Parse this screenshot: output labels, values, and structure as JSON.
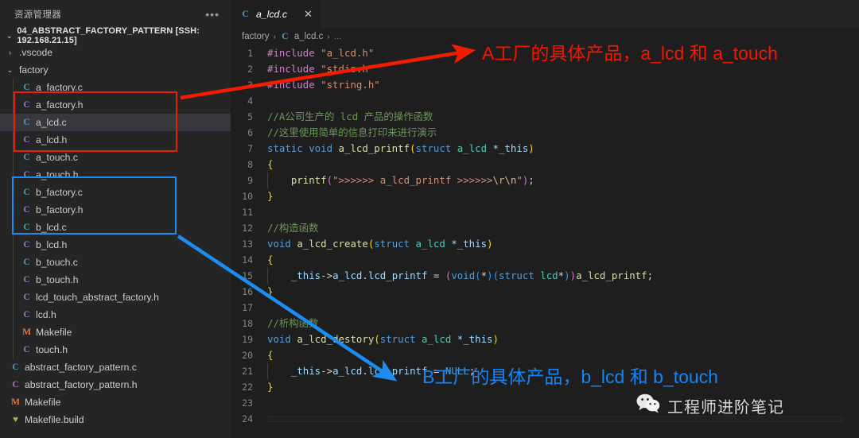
{
  "sidebar": {
    "title": "资源管理器",
    "more_label": "•••",
    "root": {
      "label": "04_ABSTRACT_FACTORY_PATTERN [SSH: 192.168.21.15]",
      "chevron": "⌄"
    },
    "items": [
      {
        "label": ".vscode",
        "icon": "folder",
        "chevron": "›",
        "depth": 1,
        "kind": "folder",
        "selected": false
      },
      {
        "label": "factory",
        "icon": "folder",
        "chevron": "⌄",
        "depth": 1,
        "kind": "folder",
        "selected": false
      },
      {
        "label": "a_factory.c",
        "icon": "C",
        "chevron": "",
        "depth": 2,
        "kind": "c",
        "selected": false
      },
      {
        "label": "a_factory.h",
        "icon": "C",
        "chevron": "",
        "depth": 2,
        "kind": "h",
        "selected": false
      },
      {
        "label": "a_lcd.c",
        "icon": "C",
        "chevron": "",
        "depth": 2,
        "kind": "c",
        "selected": true
      },
      {
        "label": "a_lcd.h",
        "icon": "C",
        "chevron": "",
        "depth": 2,
        "kind": "h",
        "selected": false
      },
      {
        "label": "a_touch.c",
        "icon": "C",
        "chevron": "",
        "depth": 2,
        "kind": "c",
        "selected": false
      },
      {
        "label": "a_touch.h",
        "icon": "C",
        "chevron": "",
        "depth": 2,
        "kind": "h",
        "selected": false
      },
      {
        "label": "b_factory.c",
        "icon": "C",
        "chevron": "",
        "depth": 2,
        "kind": "c",
        "selected": false
      },
      {
        "label": "b_factory.h",
        "icon": "C",
        "chevron": "",
        "depth": 2,
        "kind": "h",
        "selected": false
      },
      {
        "label": "b_lcd.c",
        "icon": "C",
        "chevron": "",
        "depth": 2,
        "kind": "c",
        "selected": false
      },
      {
        "label": "b_lcd.h",
        "icon": "C",
        "chevron": "",
        "depth": 2,
        "kind": "h",
        "selected": false
      },
      {
        "label": "b_touch.c",
        "icon": "C",
        "chevron": "",
        "depth": 2,
        "kind": "c",
        "selected": false
      },
      {
        "label": "b_touch.h",
        "icon": "C",
        "chevron": "",
        "depth": 2,
        "kind": "h",
        "selected": false
      },
      {
        "label": "lcd_touch_abstract_factory.h",
        "icon": "C",
        "chevron": "",
        "depth": 2,
        "kind": "h",
        "selected": false
      },
      {
        "label": "lcd.h",
        "icon": "C",
        "chevron": "",
        "depth": 2,
        "kind": "h",
        "selected": false
      },
      {
        "label": "Makefile",
        "icon": "M",
        "chevron": "",
        "depth": 2,
        "kind": "m",
        "selected": false
      },
      {
        "label": "touch.h",
        "icon": "C",
        "chevron": "",
        "depth": 2,
        "kind": "h",
        "selected": false
      },
      {
        "label": "abstract_factory_pattern.c",
        "icon": "C",
        "chevron": "",
        "depth": 1,
        "kind": "c",
        "selected": false
      },
      {
        "label": "abstract_factory_pattern.h",
        "icon": "C",
        "chevron": "",
        "depth": 1,
        "kind": "h",
        "selected": false
      },
      {
        "label": "Makefile",
        "icon": "M",
        "chevron": "",
        "depth": 1,
        "kind": "m",
        "selected": false
      },
      {
        "label": "Makefile.build",
        "icon": "♥",
        "chevron": "",
        "depth": 1,
        "kind": "build",
        "selected": false
      }
    ]
  },
  "editor": {
    "tab": {
      "icon": "C",
      "label": "a_lcd.c",
      "close": "✕"
    },
    "breadcrumb": {
      "folder": "factory",
      "sep": "›",
      "file_icon": "C",
      "file": "a_lcd.c",
      "ellipsis": "…"
    },
    "lines": [
      {
        "n": "1",
        "segments": [
          {
            "t": "#include ",
            "c": "pp"
          },
          {
            "t": "\"a_lcd.h\"",
            "c": "str"
          }
        ]
      },
      {
        "n": "2",
        "segments": [
          {
            "t": "#include ",
            "c": "pp"
          },
          {
            "t": "\"stdio.h\"",
            "c": "str"
          }
        ]
      },
      {
        "n": "3",
        "segments": [
          {
            "t": "#include ",
            "c": "pp"
          },
          {
            "t": "\"string.h\"",
            "c": "str"
          }
        ]
      },
      {
        "n": "4",
        "segments": []
      },
      {
        "n": "5",
        "segments": [
          {
            "t": "//A公司生产的 lcd 产品的操作函数",
            "c": "cmt"
          }
        ]
      },
      {
        "n": "6",
        "segments": [
          {
            "t": "//这里使用简单的信息打印来进行演示",
            "c": "cmt"
          }
        ]
      },
      {
        "n": "7",
        "segments": [
          {
            "t": "static ",
            "c": "kw"
          },
          {
            "t": "void ",
            "c": "kw"
          },
          {
            "t": "a_lcd_printf",
            "c": "fn"
          },
          {
            "t": "(",
            "c": "br1"
          },
          {
            "t": "struct ",
            "c": "kw"
          },
          {
            "t": "a_lcd ",
            "c": "typ"
          },
          {
            "t": "*_this",
            "c": "var"
          },
          {
            "t": ")",
            "c": "br1"
          }
        ]
      },
      {
        "n": "8",
        "segments": [
          {
            "t": "{",
            "c": "br1"
          }
        ]
      },
      {
        "n": "9",
        "segments": [
          {
            "t": "    ",
            "c": "pun"
          },
          {
            "t": "printf",
            "c": "fn"
          },
          {
            "t": "(",
            "c": "br2"
          },
          {
            "t": "\">>>>>> a_lcd_printf >>>>>>",
            "c": "str"
          },
          {
            "t": "\\r\\n",
            "c": "esc"
          },
          {
            "t": "\"",
            "c": "str"
          },
          {
            "t": ")",
            "c": "br2"
          },
          {
            "t": ";",
            "c": "pun"
          }
        ]
      },
      {
        "n": "10",
        "segments": [
          {
            "t": "}",
            "c": "br1"
          }
        ]
      },
      {
        "n": "11",
        "segments": []
      },
      {
        "n": "12",
        "segments": [
          {
            "t": "//构造函数",
            "c": "cmt"
          }
        ]
      },
      {
        "n": "13",
        "segments": [
          {
            "t": "void ",
            "c": "kw"
          },
          {
            "t": "a_lcd_create",
            "c": "fn"
          },
          {
            "t": "(",
            "c": "br1"
          },
          {
            "t": "struct ",
            "c": "kw"
          },
          {
            "t": "a_lcd ",
            "c": "typ"
          },
          {
            "t": "*_this",
            "c": "var"
          },
          {
            "t": ")",
            "c": "br1"
          }
        ]
      },
      {
        "n": "14",
        "segments": [
          {
            "t": "{",
            "c": "br1"
          }
        ]
      },
      {
        "n": "15",
        "segments": [
          {
            "t": "    ",
            "c": "pun"
          },
          {
            "t": "_this",
            "c": "var"
          },
          {
            "t": "->",
            "c": "pun"
          },
          {
            "t": "a_lcd",
            "c": "var"
          },
          {
            "t": ".",
            "c": "pun"
          },
          {
            "t": "lcd_printf",
            "c": "var"
          },
          {
            "t": " = ",
            "c": "pun"
          },
          {
            "t": "(",
            "c": "br2"
          },
          {
            "t": "void",
            "c": "kw"
          },
          {
            "t": "(",
            "c": "br3"
          },
          {
            "t": "*",
            "c": "pun"
          },
          {
            "t": ")",
            "c": "br3"
          },
          {
            "t": "(",
            "c": "br3"
          },
          {
            "t": "struct ",
            "c": "kw"
          },
          {
            "t": "lcd",
            "c": "typ"
          },
          {
            "t": "*",
            "c": "pun"
          },
          {
            "t": ")",
            "c": "br3"
          },
          {
            "t": ")",
            "c": "br2"
          },
          {
            "t": "a_lcd_printf",
            "c": "fn"
          },
          {
            "t": ";",
            "c": "pun"
          }
        ]
      },
      {
        "n": "16",
        "segments": [
          {
            "t": "}",
            "c": "br1"
          }
        ]
      },
      {
        "n": "17",
        "segments": []
      },
      {
        "n": "18",
        "segments": [
          {
            "t": "//析构函数",
            "c": "cmt"
          }
        ]
      },
      {
        "n": "19",
        "segments": [
          {
            "t": "void ",
            "c": "kw"
          },
          {
            "t": "a_lcd_destory",
            "c": "fn"
          },
          {
            "t": "(",
            "c": "br1"
          },
          {
            "t": "struct ",
            "c": "kw"
          },
          {
            "t": "a_lcd ",
            "c": "typ"
          },
          {
            "t": "*_this",
            "c": "var"
          },
          {
            "t": ")",
            "c": "br1"
          }
        ]
      },
      {
        "n": "20",
        "segments": [
          {
            "t": "{",
            "c": "br1"
          }
        ]
      },
      {
        "n": "21",
        "segments": [
          {
            "t": "    ",
            "c": "pun"
          },
          {
            "t": "_this",
            "c": "var"
          },
          {
            "t": "->",
            "c": "pun"
          },
          {
            "t": "a_lcd",
            "c": "var"
          },
          {
            "t": ".",
            "c": "pun"
          },
          {
            "t": "lcd_printf",
            "c": "var"
          },
          {
            "t": " = ",
            "c": "pun"
          },
          {
            "t": "NULL",
            "c": "kw"
          },
          {
            "t": ";",
            "c": "pun"
          }
        ]
      },
      {
        "n": "22",
        "segments": [
          {
            "t": "}",
            "c": "br1"
          }
        ]
      },
      {
        "n": "23",
        "segments": []
      },
      {
        "n": "24",
        "segments": []
      }
    ]
  },
  "annotations": {
    "red": {
      "text": "A工厂的具体产品，a_lcd 和 a_touch",
      "color": "#fa1400"
    },
    "blue": {
      "text": "B工厂的具体产品，b_lcd 和 b_touch",
      "color": "#1485f5"
    }
  },
  "watermark": {
    "icon": "wechat-icon",
    "text": "工程师进阶笔记"
  }
}
